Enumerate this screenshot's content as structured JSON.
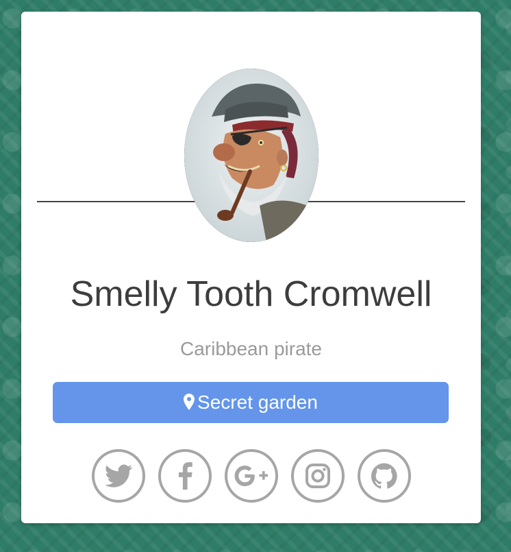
{
  "profile": {
    "avatar_icon": "pirate-portrait",
    "name": "Smelly Tooth Cromwell",
    "subtitle": "Caribbean pirate",
    "location": {
      "label": "Secret garden",
      "icon": "map-pin-icon"
    }
  },
  "socials": [
    {
      "id": "twitter",
      "icon": "twitter-icon"
    },
    {
      "id": "facebook",
      "icon": "facebook-icon"
    },
    {
      "id": "google-plus",
      "icon": "google-plus-icon"
    },
    {
      "id": "instagram",
      "icon": "instagram-icon"
    },
    {
      "id": "github",
      "icon": "github-icon"
    }
  ],
  "colors": {
    "background": "#2f7d68",
    "card": "#ffffff",
    "accent": "#6495ea",
    "name_text": "#3d3d3d",
    "subtitle_text": "#9a9a9a",
    "social_gray": "#a6a6a6"
  }
}
